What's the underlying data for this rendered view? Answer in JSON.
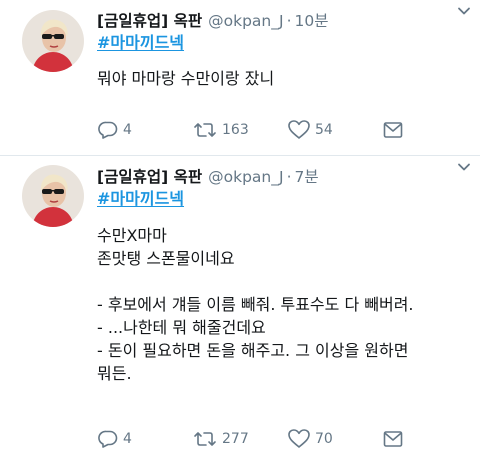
{
  "tweets": [
    {
      "name": "[금일휴업] 옥판",
      "handle": "@okpan_J",
      "time": "10분",
      "hashtag": "#마마끼드넥",
      "lines": [
        "뭐야 마마랑 수만이랑 잤니"
      ],
      "reply_count": "4",
      "retweet_count": "163",
      "like_count": "54"
    },
    {
      "name": "[금일휴업] 옥판",
      "handle": "@okpan_J",
      "time": "7분",
      "hashtag": "#마마끼드넥",
      "lines": [
        "수만X마마",
        "존맛탱 스폰물이네요",
        "",
        "- 후보에서 걔들 이름 빼줘. 투표수도 다 빼버려.",
        "- ...나한테 뭐 해줄건데요",
        "- 돈이 필요하면 돈을 해주고. 그 이상을 원하면",
        "뭐든."
      ],
      "reply_count": "4",
      "retweet_count": "277",
      "like_count": "70"
    }
  ],
  "icons": {
    "reply": "reply-icon",
    "retweet": "retweet-icon",
    "like": "heart-icon",
    "share": "share-icon",
    "menu": "chevron-down-icon"
  },
  "colors": {
    "link": "#1b95e0",
    "secondary": "#657786",
    "text": "#14171a",
    "divider": "#e1e8ed"
  }
}
